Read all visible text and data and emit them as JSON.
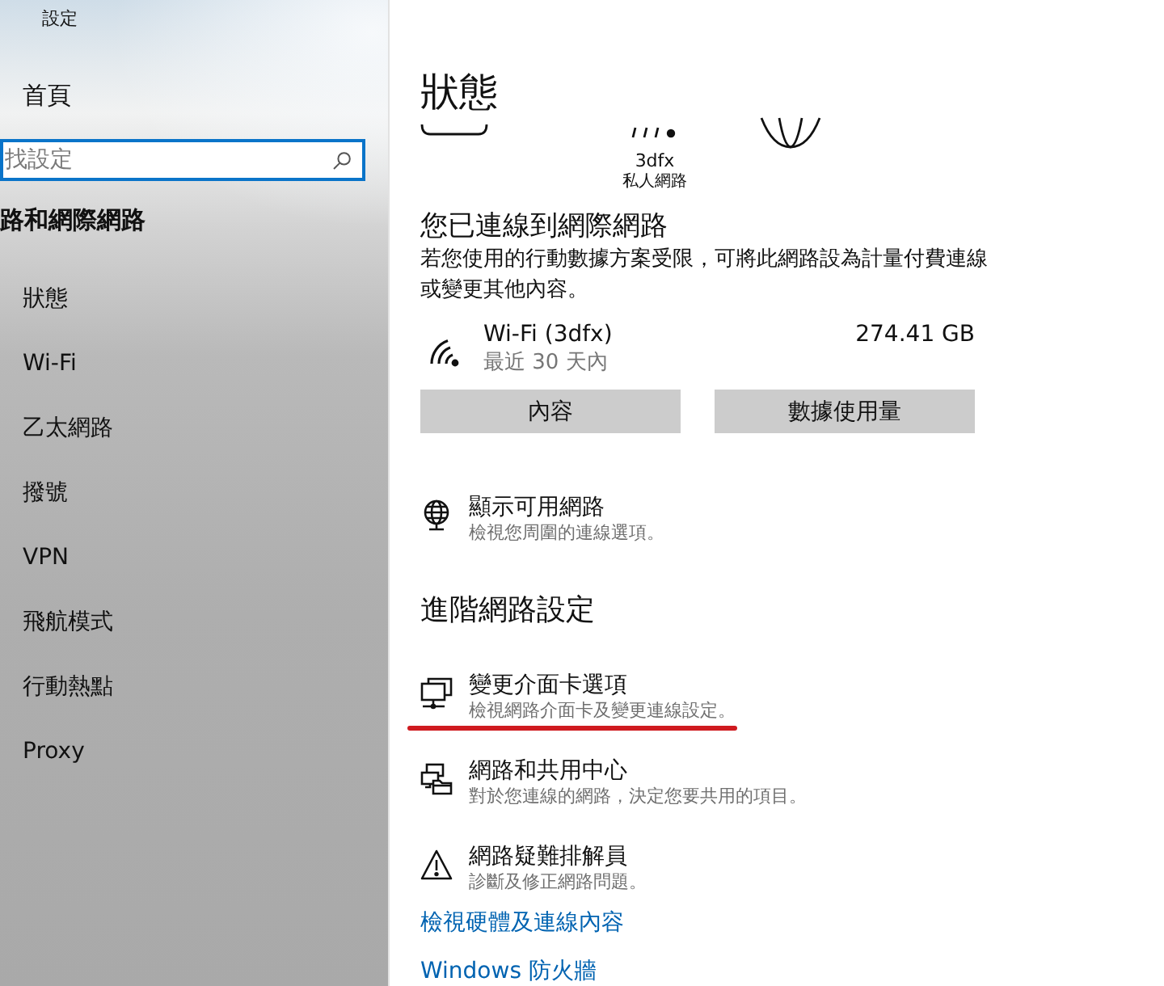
{
  "window": {
    "title": "設定"
  },
  "sidebar": {
    "home": "首頁",
    "search": {
      "placeholder": "找設定"
    },
    "section": "路和網際網路",
    "items": [
      {
        "label": "狀態"
      },
      {
        "label": "Wi-Fi"
      },
      {
        "label": "乙太網路"
      },
      {
        "label": "撥號"
      },
      {
        "label": "VPN"
      },
      {
        "label": "飛航模式"
      },
      {
        "label": "行動熱點"
      },
      {
        "label": "Proxy"
      }
    ]
  },
  "main": {
    "title": "狀態",
    "network_diagram": {
      "network_name": "3dfx",
      "network_type": "私人網路"
    },
    "connection": {
      "heading": "您已連線到網際網路",
      "description": "若您使用的行動數據方案受限，可將此網路設為計量付費連線或變更其他內容。"
    },
    "usage": {
      "name": "Wi-Fi (3dfx)",
      "period": "最近 30 天內",
      "amount": "274.41 GB"
    },
    "buttons": [
      "內容",
      "數據使用量"
    ],
    "available_networks": {
      "kind": "globe",
      "title": "顯示可用網路",
      "description": "檢視您周圍的連線選項。"
    },
    "advanced": {
      "heading": "進階網路設定",
      "items": [
        {
          "kind": "adapter",
          "title": "變更介面卡選項",
          "description": "檢視網路介面卡及變更連線設定。",
          "underlined": true
        },
        {
          "kind": "sharing",
          "title": "網路和共用中心",
          "description": "對於您連線的網路，決定您要共用的項目。",
          "underlined": false
        },
        {
          "kind": "troubleshoot",
          "title": "網路疑難排解員",
          "description": "診斷及修正網路問題。",
          "underlined": false
        }
      ]
    },
    "links": [
      "檢視硬體及連線內容",
      "Windows 防火牆"
    ]
  }
}
